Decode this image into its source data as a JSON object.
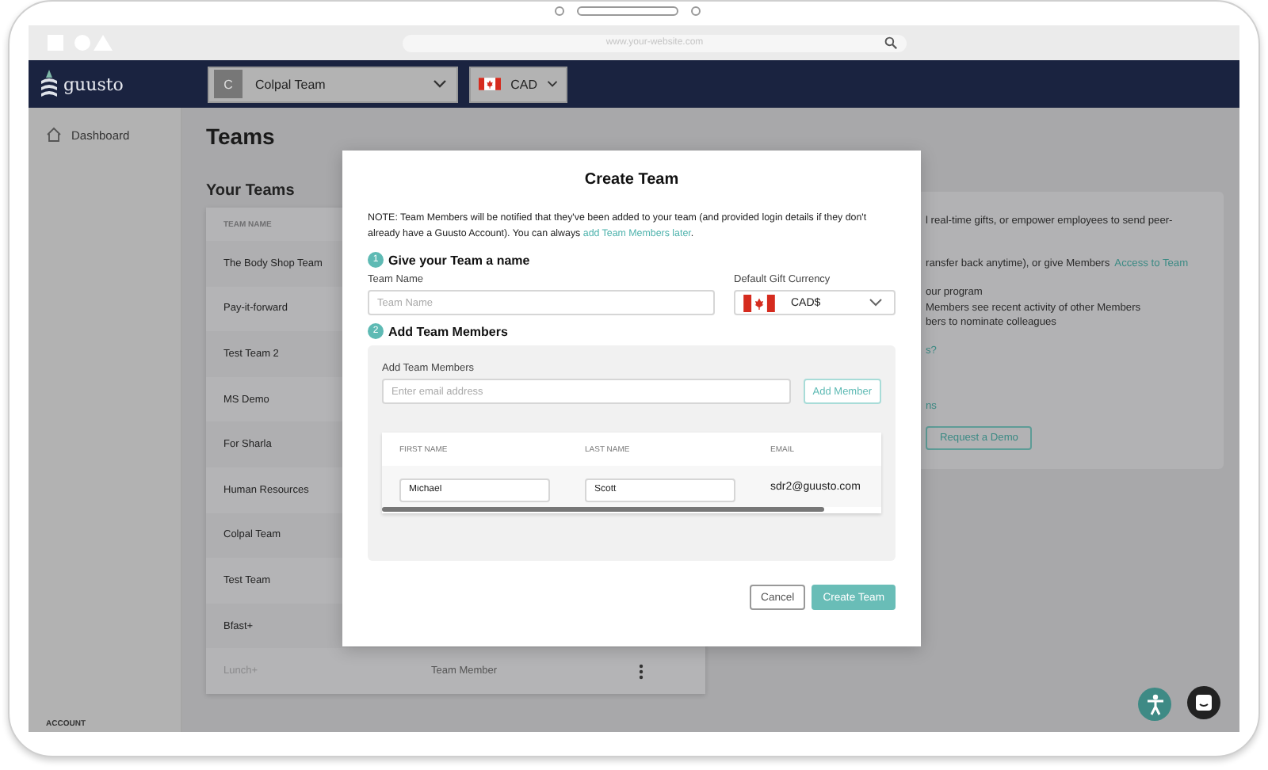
{
  "browser": {
    "url": "www.your-website.com"
  },
  "navbar": {
    "logo": "guusto",
    "team_initial": "C",
    "team": "Colpal Team",
    "currency": "CAD"
  },
  "sidebar": {
    "items": [
      {
        "label": "Dashboard",
        "selected": false
      }
    ],
    "section": "ACCOUNT"
  },
  "page": {
    "title": "Teams",
    "teams_heading": "Your Teams",
    "table": {
      "columns": [
        "TEAM NAME"
      ],
      "rows": [
        {
          "name": "The Body Shop Team",
          "dimmed": false
        },
        {
          "name": "Pay-it-forward",
          "dimmed": false
        },
        {
          "name": "Test Team 2",
          "dimmed": false
        },
        {
          "name": "MS Demo",
          "dimmed": false
        },
        {
          "name": "For Sharla",
          "dimmed": false
        },
        {
          "name": "Human Resources",
          "dimmed": false
        },
        {
          "name": "Colpal Team",
          "dimmed": false
        },
        {
          "name": "Test Team",
          "dimmed": false
        },
        {
          "name": "Bfast+",
          "dimmed": false
        },
        {
          "name": "Lunch+",
          "role": "Team Member",
          "dimmed": true
        }
      ]
    },
    "info_card": {
      "lines": [
        {
          "text": "l real-time gifts, or empower employees to send peer-"
        },
        {
          "text": "ransfer back anytime), or give Members",
          "link": "Access to Team"
        },
        {
          "text": "our program"
        },
        {
          "text": "Members see recent activity of other Members"
        },
        {
          "text": "bers to nominate colleagues"
        },
        {
          "link": "s?"
        },
        {
          "link": "ns"
        }
      ],
      "button": "Request a Demo"
    }
  },
  "modal": {
    "title": "Create Team",
    "note": {
      "text": "NOTE: Team Members will be notified that they've been added to your team (and provided login details if they don't already have a Guusto Account). You can always ",
      "link": "add Team Members later",
      "end": "."
    },
    "steps": [
      {
        "number": "1",
        "title": "Give your Team a name"
      },
      {
        "number": "2",
        "title": "Add Team Members"
      }
    ],
    "team_name": {
      "label": "Team Name",
      "placeholder": "Team Name"
    },
    "currency": {
      "label": "Default Gift Currency",
      "value": "CAD$"
    },
    "members": {
      "label": "Add Team Members",
      "placeholder": "Enter email address",
      "add_button": "Add Member",
      "columns": [
        "FIRST NAME",
        "LAST NAME",
        "EMAIL"
      ],
      "rows": [
        {
          "first_name": "Michael",
          "last_name": "Scott",
          "email": "sdr2@guusto.com"
        }
      ]
    },
    "buttons": [
      {
        "label": "Cancel",
        "kind": "secondary"
      },
      {
        "label": "Create Team",
        "kind": "primary"
      }
    ]
  }
}
